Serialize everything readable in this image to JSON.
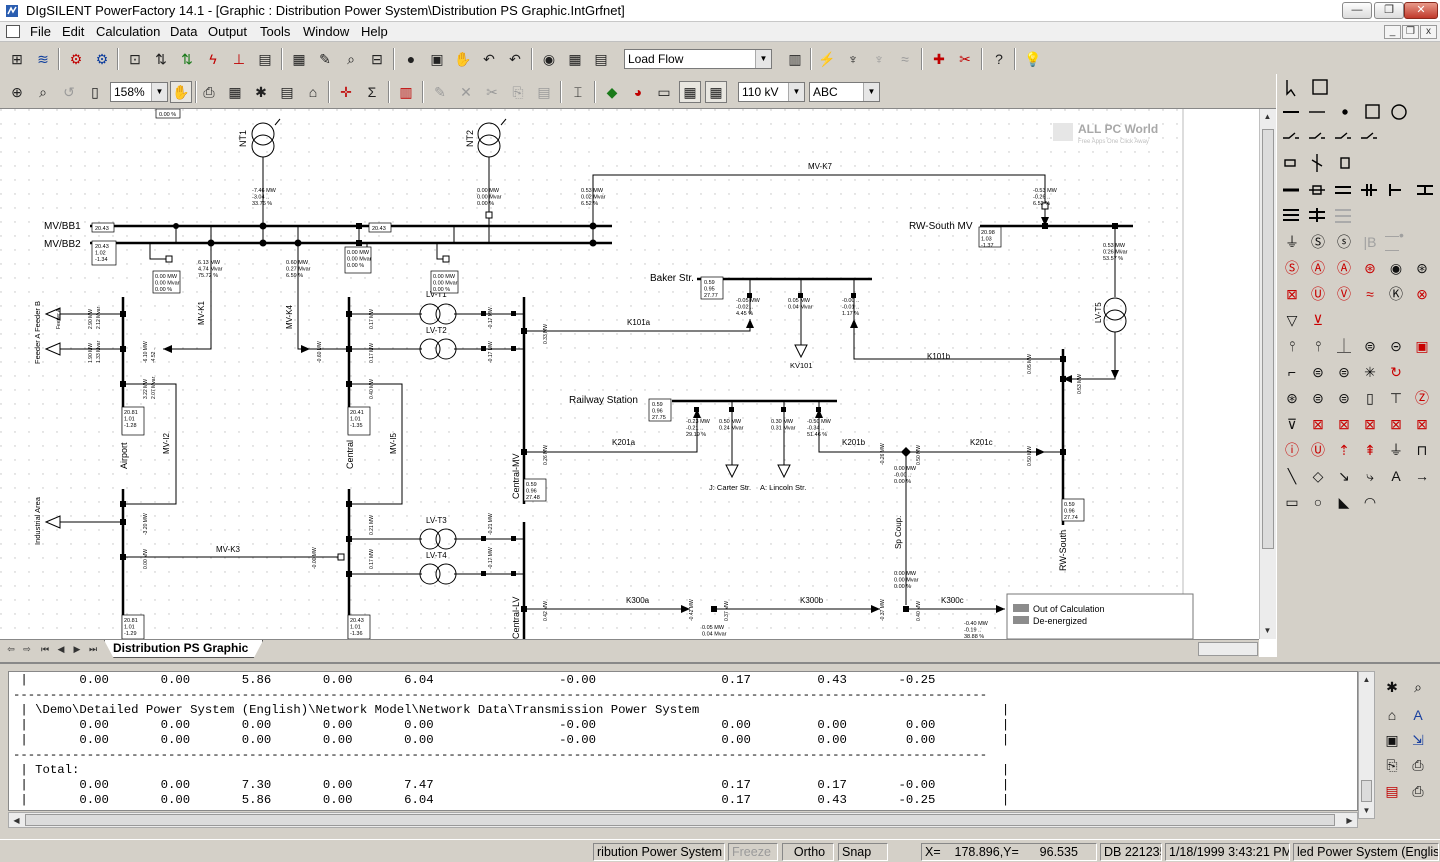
{
  "window": {
    "title": "DIgSILENT PowerFactory 14.1 - [Graphic : Distribution Power System\\Distribution PS Graphic.IntGrfnet]",
    "minimize_glyph": "—",
    "restore_glyph": "❐",
    "close_glyph": "✕"
  },
  "menu": {
    "items": [
      "File",
      "Edit",
      "Calculation",
      "Data",
      "Output",
      "Tools",
      "Window",
      "Help"
    ],
    "mdi_minimize_glyph": "_",
    "mdi_restore_glyph": "❐",
    "mdi_close_glyph": "x"
  },
  "toolbar1": {
    "icons": [
      {
        "name": "network-model-icon",
        "glyph": "⊞"
      },
      {
        "name": "network-data-icon",
        "glyph": "≋"
      },
      {
        "name": "study-case-icon",
        "glyph": "⚙"
      },
      {
        "name": "edit-study-case-icon",
        "glyph": "⚙"
      },
      {
        "name": "data-manager-icon",
        "glyph": "⊡"
      },
      {
        "name": "load-flow-icon",
        "glyph": "⇅"
      },
      {
        "name": "short-circuit-icon",
        "glyph": "⇅"
      },
      {
        "name": "fault-icon",
        "glyph": "ϟ"
      },
      {
        "name": "rms-simulation-icon",
        "glyph": "⊥"
      },
      {
        "name": "reports-icon",
        "glyph": "▤"
      },
      {
        "name": "results-icon",
        "glyph": "▦"
      },
      {
        "name": "edit-results-icon",
        "glyph": "✎"
      },
      {
        "name": "graphic-search-icon",
        "glyph": "⌕"
      },
      {
        "name": "station-icon",
        "glyph": "⊟"
      },
      {
        "name": "record-icon",
        "glyph": "●"
      },
      {
        "name": "save-icon",
        "glyph": "▣"
      },
      {
        "name": "pan-icon",
        "glyph": "✋"
      },
      {
        "name": "undo-icon",
        "glyph": "↶"
      },
      {
        "name": "calculation-icon",
        "glyph": "◉"
      },
      {
        "name": "table-icon",
        "glyph": "▦"
      },
      {
        "name": "report-icon",
        "glyph": "▤"
      }
    ],
    "calc_combo_value": "Load Flow",
    "right_icons": [
      {
        "name": "plot-icon",
        "glyph": "▥"
      },
      {
        "name": "contingency-icon",
        "glyph": "⚡"
      },
      {
        "name": "harmonics-icon",
        "glyph": "♆"
      },
      {
        "name": "stability-icon",
        "glyph": "♆"
      },
      {
        "name": "frequency-icon",
        "glyph": "≈"
      },
      {
        "name": "add-element-icon",
        "glyph": "✚"
      },
      {
        "name": "remove-element-icon",
        "glyph": "✂"
      },
      {
        "name": "help-icon",
        "glyph": "?"
      },
      {
        "name": "hint-icon",
        "glyph": "💡"
      }
    ]
  },
  "toolbar2": {
    "zoom_value": "158%",
    "voltage_value": "110 kV",
    "text_style_value": "ABC",
    "icons": [
      {
        "name": "zoom-in-icon",
        "glyph": "⊕"
      },
      {
        "name": "magnifier-icon",
        "glyph": "⌕"
      },
      {
        "name": "zoom-back-icon",
        "glyph": "↺"
      },
      {
        "name": "page-icon",
        "glyph": "▯"
      },
      {
        "name": "hand-icon",
        "glyph": "✋"
      },
      {
        "name": "print-icon",
        "glyph": "⎙"
      },
      {
        "name": "grid-icon",
        "glyph": "▦"
      },
      {
        "name": "new-graphic-icon",
        "glyph": "✱"
      },
      {
        "name": "open-graphic-icon",
        "glyph": "▤"
      },
      {
        "name": "folder-open-icon",
        "glyph": "⌂"
      },
      {
        "name": "insert-node-icon",
        "glyph": "✛"
      },
      {
        "name": "sum-icon",
        "glyph": "Σ"
      },
      {
        "name": "chart-icon",
        "glyph": "▥"
      },
      {
        "name": "edit-icon",
        "glyph": "✎"
      },
      {
        "name": "delete-icon",
        "glyph": "✕"
      },
      {
        "name": "cut-icon",
        "glyph": "✂"
      },
      {
        "name": "copy-icon",
        "glyph": "⎘"
      },
      {
        "name": "paste-icon",
        "glyph": "▤"
      },
      {
        "name": "align-icon",
        "glyph": "⌶"
      },
      {
        "name": "color-fill-icon",
        "glyph": "◆"
      },
      {
        "name": "palette-icon",
        "glyph": "◕"
      },
      {
        "name": "layer-icon",
        "glyph": "▭"
      },
      {
        "name": "frame-icon",
        "glyph": "▦"
      },
      {
        "name": "frame-grid-icon",
        "glyph": "▦"
      }
    ]
  },
  "diagram": {
    "watermark_title": "ALL PC World",
    "watermark_subtitle": "Free Apps One Click Away",
    "busbars": [
      "MV/BB1",
      "MV/BB2"
    ],
    "bus_labels": {
      "rw_south_mv": "RW-South MV",
      "baker": "Baker Str.",
      "railway": "Railway Station",
      "airport": "Airport",
      "central": "Central",
      "central_mv": "Central-MV",
      "industrial": "Industrial Area",
      "feeder": "Feeder A  Feeder B",
      "rw_south": "RW-South",
      "central_lv": "Central-LV"
    },
    "transformers": [
      "NT1",
      "NT2",
      "LV-T1",
      "LV-T2",
      "LV-T3",
      "LV-T4",
      "LV-T5"
    ],
    "lines": [
      "MV-K7",
      "MV-K1",
      "MV-K4",
      "MV-I2",
      "MV-I5",
      "MV-K3",
      "K101a",
      "K101b",
      "K201a",
      "K201b",
      "K201c",
      "K300a",
      "K300b",
      "K300c",
      "Sp Coup."
    ],
    "loads": [
      "KV101",
      "J: Carter Str.",
      "A: Lincoln Str."
    ],
    "result_boxes": {
      "top_small": "0.00 %",
      "nt1": "-7.46 MW\n-3.04 ..\n33.76 %",
      "nt2": "0.00 MW\n0.00 Mvar\n0.00 %",
      "mvk7_left": "0.53 MW\n0.02 Mvar\n6.52 %",
      "mvk7_right": "-0.53 MW\n-0.26 ..\n6.52 %",
      "bb1_val": "20.43",
      "bb2_val": "20.43\n1.02\n-1.34",
      "bb_center": "20.43",
      "rw_mv_box": "20.98\n1.03\n-1.37",
      "rw_mv_flow": "0.53 MW\n0.26 Mvar\n53.57 %",
      "k1_flow": "6.13 MW\n4.74 Mvar\n75.72 %",
      "k4_flow": "0.60 MW\n0.27 Mvar\n6.59 %",
      "bb2_flow_a": "0.00 MW\n0.00 Mvar\n0.00 %",
      "bb2_flow_b": "0.00 MW\n0.00 Mvar\n0.00 %",
      "bb2_flow_c": "0.00 MW\n0.00 Mvar\n0.00 %",
      "baker_box": "0.59\n0.95\n27.77",
      "baker_load1": "-0.05 MW\n-0.02 ..\n4.45 %",
      "baker_load2": "0.05 MW\n0.04 Mvar",
      "baker_load3": "-0.00 ..\n-0.01 ..\n1.17 %",
      "railway_box": "0.59\n0.96\n27.75",
      "railway_load1": "-0.23 MW\n-0.21 ..\n29.19 %",
      "railway_load2": "0.50 MW\n0.24 Mvar",
      "railway_load3": "0.30 MW\n0.31 Mvar",
      "railway_load4": "-0.50 MW\n-0.34 ..\n51.46 %",
      "airport_box": "20.81\n1.01\n-1.28",
      "central_box": "20.41\n1.01\n-1.35",
      "central_mv_box": "0.59\n0.96\n27.48",
      "rw_south_box": "0.59\n0.96\n27.74",
      "central_lv_box": "20.43\n1.01\n-1.36",
      "industrial_box": "20.81\n1.01\n-1.29",
      "sp_coup_top": "0.00 MW\n-0.00 ..\n0.00 %",
      "sp_coup_bottom": "0.00 MW\n0.00 Mvar\n0.00 %",
      "k300_load": "0.05 MW\n0.04 Mvar",
      "k300c_flow": "-0.40 MW\n-0.19 ..\n38.88 %"
    },
    "legend": [
      {
        "label": "Out of Calculation",
        "color": "#8c8c8c"
      },
      {
        "label": "De-energized",
        "color": "#8c8c8c"
      }
    ]
  },
  "tabs": {
    "active": "Distribution PS Graphic"
  },
  "output": {
    "lines": [
      " |       0.00       0.00       5.86       0.00       6.04                 -0.00                 0.17         0.43       -0.25",
      "------------------------------------------------------------------------------------------------------------------------------------",
      " | \\Demo\\Detailed Power System (English)\\Network Model\\Network Data\\Transmission Power System                                         |",
      " |       0.00       0.00       0.00       0.00       0.00                 -0.00                 0.00         0.00        0.00         |",
      " |       0.00       0.00       0.00       0.00       0.00                 -0.00                 0.00         0.00        0.00         |",
      "------------------------------------------------------------------------------------------------------------------------------------",
      " | Total:                                                                                                                             |",
      " |       0.00       0.00       7.30       0.00       7.47                                       0.17         0.17       -0.00         |",
      " |       0.00       0.00       5.86       0.00       6.04                                       0.17         0.43       -0.25         |"
    ]
  },
  "status": {
    "project": "ribution Power System",
    "freeze": "Freeze",
    "ortho": "Ortho",
    "snap": "Snap",
    "coords": "X=    178.896,Y=      96.535",
    "db": "DB 221235",
    "datetime": "1/18/1999 3:43:21 PM",
    "case": "led Power System (English)"
  }
}
